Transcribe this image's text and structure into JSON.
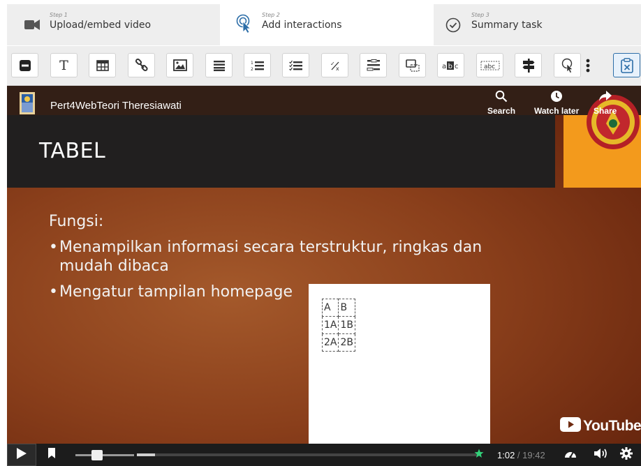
{
  "steps": [
    {
      "number": "Step 1",
      "label": "Upload/embed video",
      "icon": "video-camera-icon"
    },
    {
      "number": "Step 2",
      "label": "Add interactions",
      "icon": "pointer-icon"
    },
    {
      "number": "Step 3",
      "label": "Summary task",
      "icon": "check-circle-icon"
    }
  ],
  "toolbar": {
    "buttons": [
      {
        "name": "label-button",
        "icon": "label-icon",
        "text": ""
      },
      {
        "name": "text-button",
        "icon": "text-icon",
        "text": "T"
      },
      {
        "name": "table-button",
        "icon": "table-icon",
        "text": ""
      },
      {
        "name": "link-button",
        "icon": "link-icon",
        "text": ""
      },
      {
        "name": "image-button",
        "icon": "image-icon",
        "text": ""
      },
      {
        "name": "statements-button",
        "icon": "list-icon",
        "text": ""
      },
      {
        "name": "single-choice-button",
        "icon": "ordered-list-icon",
        "text": ""
      },
      {
        "name": "multiple-choice-button",
        "icon": "checklist-icon",
        "text": ""
      },
      {
        "name": "true-false-button",
        "icon": "true-false-icon",
        "text": "⁺⁄ₓ"
      },
      {
        "name": "fill-blanks-button",
        "icon": "fill-blanks-icon",
        "text": ""
      },
      {
        "name": "drag-drop-button",
        "icon": "drag-drop-icon",
        "text": ""
      },
      {
        "name": "mark-words-button",
        "icon": "mark-words-icon",
        "text": "a▆c"
      },
      {
        "name": "drag-text-button",
        "icon": "drag-text-icon",
        "text": "abc"
      },
      {
        "name": "crossroads-button",
        "icon": "crossroads-icon",
        "text": ""
      },
      {
        "name": "navigation-hotspot-button",
        "icon": "hotspot-icon",
        "text": ""
      },
      {
        "name": "more-button",
        "icon": "kebab-icon",
        "text": "⋮"
      },
      {
        "name": "submit-screen-button",
        "icon": "submit-screen-icon",
        "text": ""
      }
    ]
  },
  "video": {
    "channel_title": "Pert4WebTeori Theresiawati",
    "actions": [
      {
        "label": "Search",
        "icon": "search-icon"
      },
      {
        "label": "Watch later",
        "icon": "clock-icon"
      },
      {
        "label": "Share",
        "icon": "share-icon"
      }
    ],
    "slide": {
      "title": "TABEL",
      "heading": "Fungsi:",
      "bullets": [
        {
          "line1": "Menampilkan informasi secara terstruktur, ringkas dan",
          "line2": "mudah dibaca"
        },
        {
          "line1": "Mengatur tampilan homepage",
          "line2": ""
        }
      ]
    },
    "table": [
      [
        "A",
        "B"
      ],
      [
        "1A",
        "1B"
      ],
      [
        "2A",
        "2B"
      ]
    ],
    "brand": "YouTube"
  },
  "controls": {
    "current_time": "1:02",
    "separator": " / ",
    "duration": "19:42",
    "progress": 0.0524
  },
  "colors": {
    "accent": "#2d6ea8",
    "slide_bg": "#8a3f1b",
    "title_bar": "#211f1f",
    "orange": "#f39a1c"
  }
}
